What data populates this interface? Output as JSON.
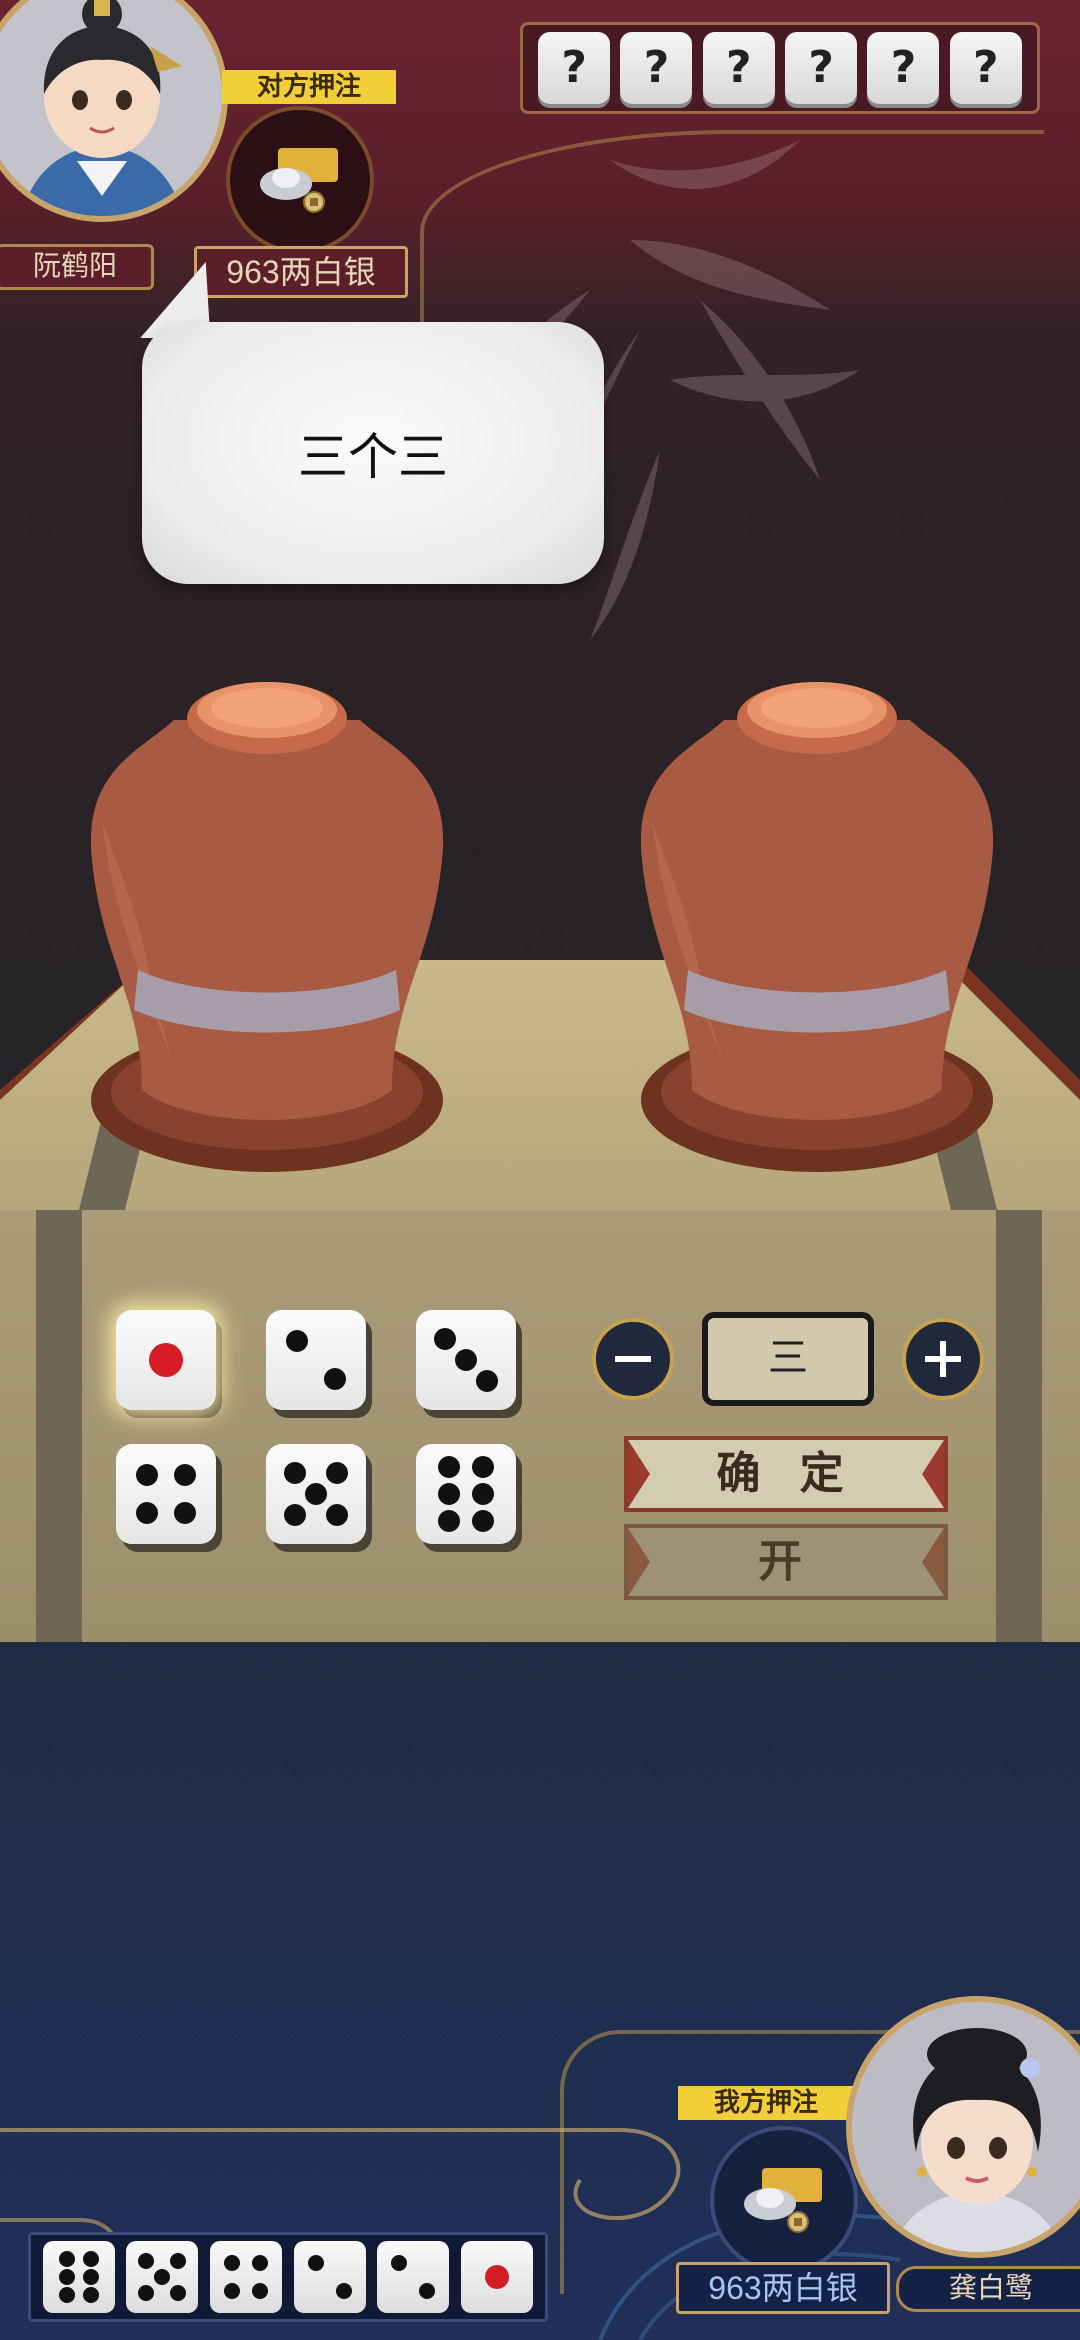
{
  "opponent": {
    "name": "阮鹤阳",
    "stake_label": "对方押注",
    "silver": "963两白银",
    "hidden_dice": [
      "?",
      "?",
      "?",
      "?",
      "?",
      "?"
    ]
  },
  "bid_bubble": {
    "text": "三个三"
  },
  "face_selector": {
    "faces": [
      1,
      2,
      3,
      4,
      5,
      6
    ],
    "selected_face": 1
  },
  "count_control": {
    "value": "三",
    "minus_icon": "minus-icon",
    "plus_icon": "plus-icon"
  },
  "actions": {
    "confirm_label": "确 定",
    "open_label": "开"
  },
  "player": {
    "name": "龚白鹭",
    "stake_label": "我方押注",
    "silver": "963两白银",
    "dice": [
      6,
      5,
      4,
      2,
      2,
      1
    ]
  },
  "colors": {
    "accent_gold": "#c8a36a",
    "stake_yellow": "#f2cf36",
    "pip_red": "#d61c24",
    "opponent_banner": "#6a2430",
    "player_banner": "#1f2c4c"
  }
}
